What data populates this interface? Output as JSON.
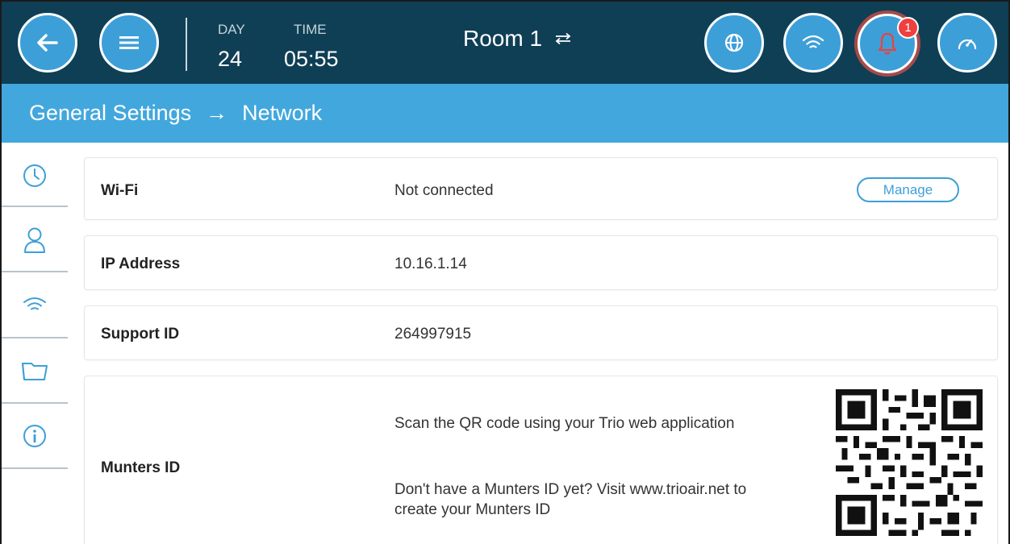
{
  "header": {
    "day_label": "DAY",
    "day_value": "24",
    "time_label": "TIME",
    "time_value": "05:55",
    "room_name": "Room 1",
    "alarm_count": "1",
    "colors": {
      "bar": "#0f3f55",
      "button": "#3d9fd8",
      "alarm": "#a64a4a",
      "badge": "#ef3f3f"
    },
    "icons": [
      "back-arrow-icon",
      "menu-icon",
      "swap-arrows-icon",
      "globe-icon",
      "wifi-icon",
      "bell-icon",
      "gauge-icon"
    ]
  },
  "breadcrumb": {
    "parent": "General Settings",
    "separator": "→",
    "current": "Network"
  },
  "sidebar": {
    "items": [
      {
        "icon": "clock-icon",
        "active": false
      },
      {
        "icon": "user-icon",
        "active": false
      },
      {
        "icon": "wifi-icon",
        "active": true
      },
      {
        "icon": "folder-icon",
        "active": false
      },
      {
        "icon": "info-icon",
        "active": false
      }
    ]
  },
  "network": {
    "wifi": {
      "label": "Wi-Fi",
      "value": "Not connected",
      "button_label": "Manage"
    },
    "ip": {
      "label": "IP Address",
      "value": "10.16.1.14"
    },
    "support": {
      "label": "Support ID",
      "value": "264997915"
    },
    "munters": {
      "label": "Munters ID",
      "scan_text": "Scan the QR code using your Trio web application",
      "visit_line1": "Don't have a Munters ID yet? Visit www.trioair.net to",
      "visit_line2": "create your Munters ID",
      "qr_icon": "qr-code-icon"
    }
  }
}
